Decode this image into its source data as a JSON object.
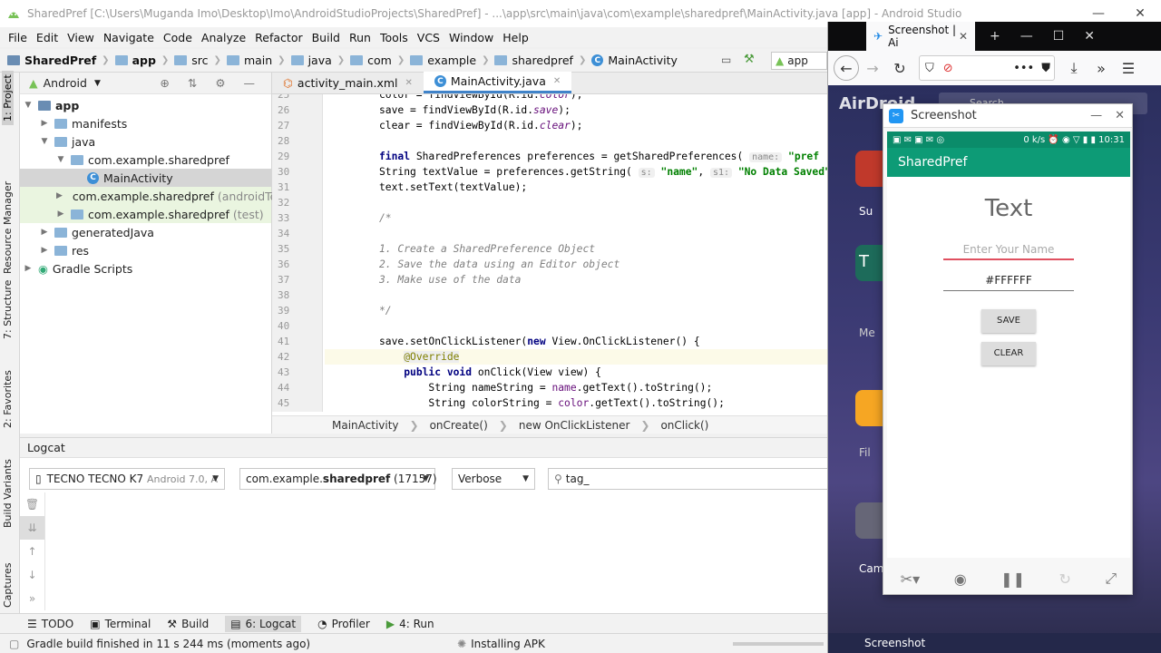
{
  "window": {
    "title": "SharedPref [C:\\Users\\Muganda Imo\\Desktop\\Imo\\AndroidStudioProjects\\SharedPref] - ...\\app\\src\\main\\java\\com\\example\\sharedpref\\MainActivity.java [app] - Android Studio"
  },
  "menu": [
    "File",
    "Edit",
    "View",
    "Navigate",
    "Code",
    "Analyze",
    "Refactor",
    "Build",
    "Run",
    "Tools",
    "VCS",
    "Window",
    "Help"
  ],
  "navbar": {
    "crumbs": [
      "SharedPref",
      "app",
      "src",
      "main",
      "java",
      "com",
      "example",
      "sharedpref",
      "MainActivity"
    ],
    "run_config": "app"
  },
  "side_tabs": {
    "project": "1: Project",
    "resource_manager": "Resource Manager",
    "structure": "7: Structure",
    "favorites": "2: Favorites",
    "build_variants": "Build Variants",
    "captures": "Captures"
  },
  "project_panel": {
    "view": "Android",
    "tree": [
      {
        "label": "app",
        "suffix": "",
        "indent": 0,
        "arrow": "▼"
      },
      {
        "label": "manifests",
        "suffix": "",
        "indent": 1,
        "arrow": "▶"
      },
      {
        "label": "java",
        "suffix": "",
        "indent": 1,
        "arrow": "▼"
      },
      {
        "label": "com.example.sharedpref",
        "suffix": "",
        "indent": 2,
        "arrow": "▼"
      },
      {
        "label": "MainActivity",
        "suffix": "",
        "indent": 3,
        "arrow": ""
      },
      {
        "label": "com.example.sharedpref",
        "suffix": "(androidTest)",
        "indent": 2,
        "arrow": "▶"
      },
      {
        "label": "com.example.sharedpref",
        "suffix": "(test)",
        "indent": 2,
        "arrow": "▶"
      },
      {
        "label": "generatedJava",
        "suffix": "",
        "indent": 1,
        "arrow": "▶"
      },
      {
        "label": "res",
        "suffix": "",
        "indent": 1,
        "arrow": "▶"
      },
      {
        "label": "Gradle Scripts",
        "suffix": "",
        "indent": 0,
        "arrow": "▶"
      }
    ]
  },
  "editor": {
    "tabs": [
      "activity_main.xml",
      "MainActivity.java"
    ],
    "line_numbers": [
      "25",
      "26",
      "27",
      "28",
      "29",
      "30",
      "31",
      "32",
      "33",
      "34",
      "35",
      "36",
      "37",
      "38",
      "39",
      "40",
      "41",
      "42",
      "43",
      "44",
      "45"
    ],
    "breadcrumbs": [
      "MainActivity",
      "onCreate()",
      "new OnClickListener",
      "onClick()"
    ]
  },
  "logcat": {
    "title": "Logcat",
    "device": "TECNO TECNO K7",
    "device_detail": "Android 7.0, A",
    "process_prefix": "com.example.",
    "process_bold": "sharedpref",
    "process_pid": "(17157)",
    "level": "Verbose",
    "filter": "tag_"
  },
  "bottom_tabs": [
    "TODO",
    "Terminal",
    "Build",
    "6: Logcat",
    "Profiler",
    "4: Run"
  ],
  "status": {
    "message": "Gradle build finished in 11 s 244 ms (moments ago)",
    "task": "Installing APK"
  },
  "firefox": {
    "tab_title": "Screenshot | Ai"
  },
  "airdroid": {
    "search_placeholder": "Search",
    "logo": "AirDroid",
    "labels": [
      "Su",
      "T",
      "Me",
      "Fil",
      "Cam"
    ],
    "screenshot_window_title": "Screenshot",
    "taskbar": "Screenshot"
  },
  "phone": {
    "status_left": "▣ ✉ ▣ ✉ ◎",
    "status_right": "0 k/s ⏰ ◉ ▽ ▮ ▮ 10:31",
    "app_title": "SharedPref",
    "text_view": "Text",
    "name_hint": "Enter Your Name",
    "color_value": "#FFFFFF",
    "save_label": "SAVE",
    "clear_label": "CLEAR"
  },
  "colors": {
    "accent": "#4083c9",
    "phone_appbar": "#0d9b76",
    "phone_status": "#0b8c6a",
    "name_underline": "#e05060"
  }
}
